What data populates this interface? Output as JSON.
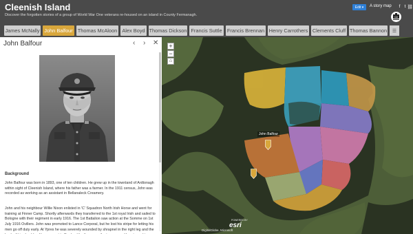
{
  "header": {
    "title": "Cleenish Island",
    "subtitle": "Discover the forgotten stories of a group of World War One veterans re-housed on an island in County Fermanagh.",
    "edit_label": "Edit ▾",
    "story_map_label": "A story map",
    "share_icons": [
      "facebook-icon",
      "twitter-icon",
      "link-icon"
    ],
    "logo_text": "CAI"
  },
  "tabs": [
    {
      "label": "James McNally",
      "active": false
    },
    {
      "label": "John Balfour",
      "active": true
    },
    {
      "label": "Thomas McAloon",
      "active": false
    },
    {
      "label": "Alex Boyd",
      "active": false
    },
    {
      "label": "Thomas Dickson",
      "active": false
    },
    {
      "label": "Francis Suttle",
      "active": false
    },
    {
      "label": "Francis Brennan",
      "active": false
    },
    {
      "label": "Henry Carrothers",
      "active": false
    },
    {
      "label": "Clements Cluff",
      "active": false
    },
    {
      "label": "Thomas Bannon",
      "active": false
    }
  ],
  "tab_menu_icon": "menu-icon",
  "panel": {
    "title": "John Balfour",
    "prev_icon": "‹",
    "next_icon": "›",
    "close_icon": "✕",
    "section_heading": "Background",
    "para1": "John Balfour was born in 1893, one of ten children. He grew up in the townland of Ardtonagh within sight of Cleenish Island, where his father was a farmer. In the 1911 census, John was recorded as working as an assistant in Bellanaleck Creamery.",
    "para2": "John and his neighbour Willie Nixon enlisted in 'C' Squadron North Irish Horse and went for training at Finner Camp. Shortly afterwards they transferred to the 1st royal Irish and sailed to Bologne with their regiment in early 1916. The 1st Battalion saw action at the Somme on 1st July 1916 Ovillers. John was promoted to Lance Corporal, but he lost his stripe for letting his men go off duty early. At Ypres he was severely wounded by shrapnel in the right leg and the back of his shoulder. He was sent to England for three months to recover. He returned to Ypres in the second half of 1917 in trenches at Passchendaele where his regiment suffered"
  },
  "map": {
    "zoom_in": "+",
    "zoom_out": "−",
    "home_icon": "⌂",
    "tooltip": "John Balfour",
    "attribution": "DigitalGlobe, Microsoft",
    "powered_by": "POWERED BY",
    "esri": "esri",
    "colors": {
      "water": "#2a3322",
      "land": "#4d5e38",
      "parcels": [
        "#e0b83a",
        "#d4b33c",
        "#3fa6c8",
        "#2e9ec4",
        "#c89a4a",
        "#b67fd0",
        "#8a7fcf",
        "#6c7fd4",
        "#d77fb3",
        "#e06a6a",
        "#cc7a3a",
        "#d9a73c",
        "#a9b67b"
      ]
    }
  }
}
